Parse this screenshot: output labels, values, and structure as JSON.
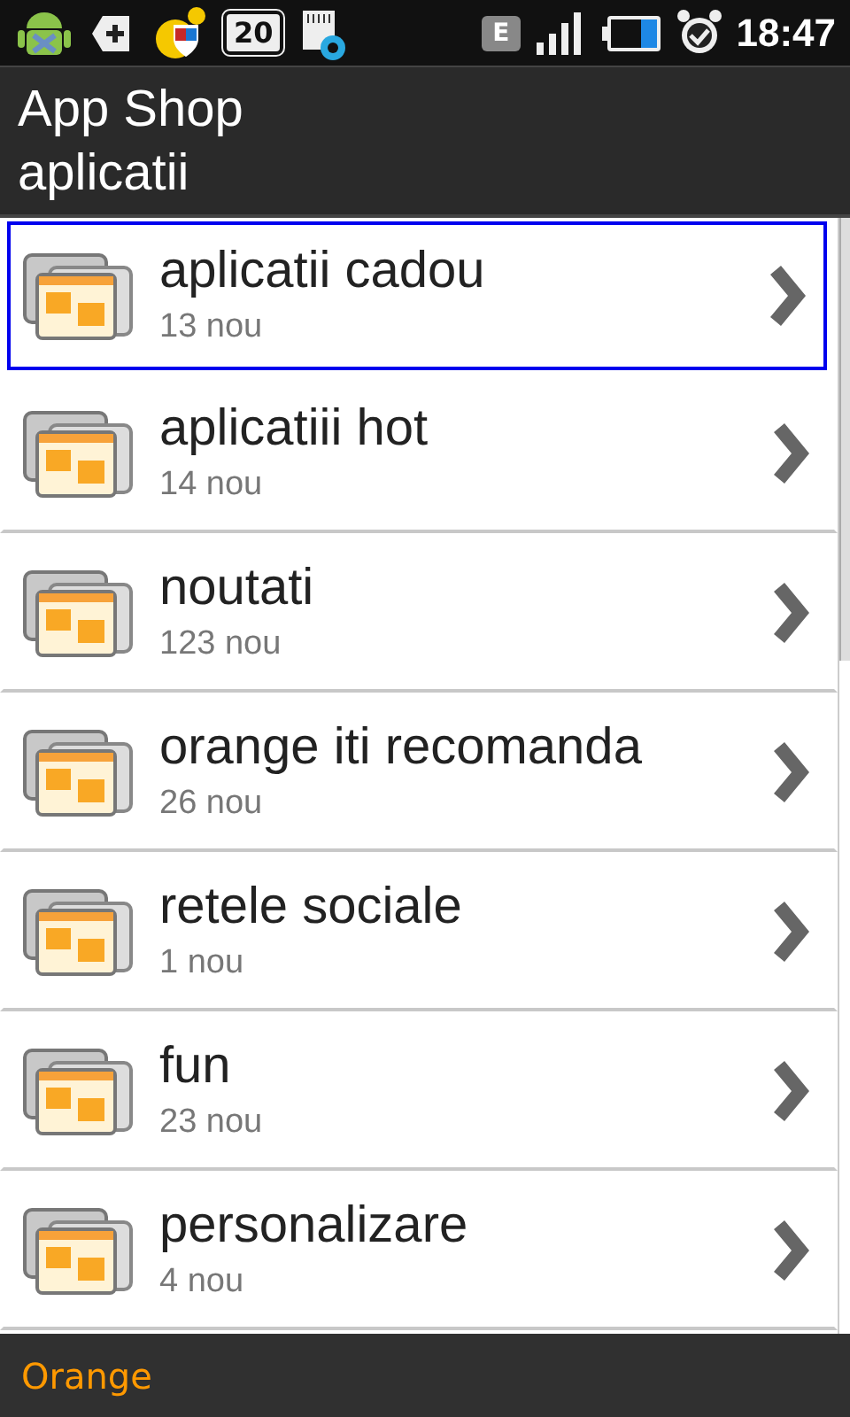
{
  "status_bar": {
    "notification_count": "20",
    "network_type": "E",
    "time": "18:47"
  },
  "header": {
    "title": "App Shop",
    "subtitle": "aplicatii"
  },
  "items": [
    {
      "title": "aplicatii cadou",
      "count": "13 nou",
      "selected": true
    },
    {
      "title": "aplicatiii hot",
      "count": "14 nou",
      "selected": false
    },
    {
      "title": "noutati",
      "count": "123 nou",
      "selected": false
    },
    {
      "title": "orange iti recomanda",
      "count": "26 nou",
      "selected": false
    },
    {
      "title": "retele sociale",
      "count": "1 nou",
      "selected": false
    },
    {
      "title": "fun",
      "count": "23 nou",
      "selected": false
    },
    {
      "title": "personalizare",
      "count": "4 nou",
      "selected": false
    }
  ],
  "footer": {
    "label": "Orange"
  }
}
